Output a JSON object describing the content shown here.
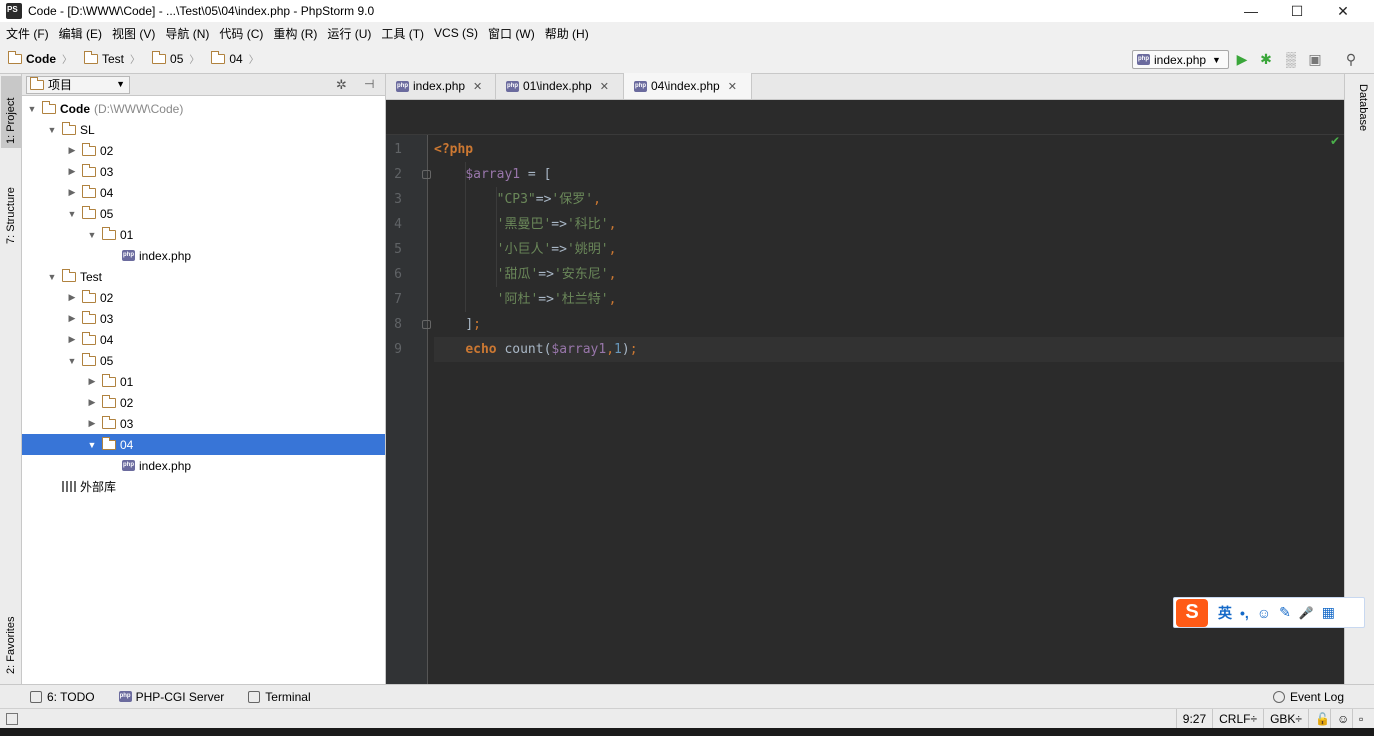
{
  "window": {
    "title": "Code - [D:\\WWW\\Code] - ...\\Test\\05\\04\\index.php - PhpStorm 9.0",
    "minimize": "—",
    "maximize": "☐",
    "close": "✕"
  },
  "menu": [
    "文件 (F)",
    "编辑 (E)",
    "视图 (V)",
    "导航 (N)",
    "代码 (C)",
    "重构 (R)",
    "运行 (U)",
    "工具 (T)",
    "VCS (S)",
    "窗口 (W)",
    "帮助 (H)"
  ],
  "breadcrumbs": [
    "Code",
    "Test",
    "05",
    "04"
  ],
  "toolbar": {
    "run_config": "index.php",
    "run_icon": "play-icon",
    "debug_icon": "bug-icon",
    "search_icon": "search-icon"
  },
  "left_stripe": {
    "project": "1: Project",
    "structure": "7: Structure",
    "favorites": "2: Favorites"
  },
  "right_stripe": {
    "database": "Database"
  },
  "project_panel": {
    "view": "项目",
    "tree": [
      {
        "label": "Code",
        "hint": "(D:\\WWW\\Code)",
        "depth": 0,
        "expanded": true,
        "type": "folder"
      },
      {
        "label": "SL",
        "depth": 1,
        "expanded": true,
        "type": "folder"
      },
      {
        "label": "02",
        "depth": 2,
        "expanded": false,
        "type": "folder"
      },
      {
        "label": "03",
        "depth": 2,
        "expanded": false,
        "type": "folder"
      },
      {
        "label": "04",
        "depth": 2,
        "expanded": false,
        "type": "folder"
      },
      {
        "label": "05",
        "depth": 2,
        "expanded": true,
        "type": "folder"
      },
      {
        "label": "01",
        "depth": 3,
        "expanded": true,
        "type": "folder"
      },
      {
        "label": "index.php",
        "depth": 4,
        "type": "php"
      },
      {
        "label": "Test",
        "depth": 1,
        "expanded": true,
        "type": "folder"
      },
      {
        "label": "02",
        "depth": 2,
        "expanded": false,
        "type": "folder"
      },
      {
        "label": "03",
        "depth": 2,
        "expanded": false,
        "type": "folder"
      },
      {
        "label": "04",
        "depth": 2,
        "expanded": false,
        "type": "folder"
      },
      {
        "label": "05",
        "depth": 2,
        "expanded": true,
        "type": "folder"
      },
      {
        "label": "01",
        "depth": 3,
        "expanded": false,
        "type": "folder"
      },
      {
        "label": "02",
        "depth": 3,
        "expanded": false,
        "type": "folder"
      },
      {
        "label": "03",
        "depth": 3,
        "expanded": false,
        "type": "folder"
      },
      {
        "label": "04",
        "depth": 3,
        "expanded": true,
        "type": "folder",
        "selected": true
      },
      {
        "label": "index.php",
        "depth": 4,
        "type": "php"
      },
      {
        "label": "外部库",
        "depth": 1,
        "type": "lib"
      }
    ]
  },
  "tabs": [
    {
      "label": "index.php",
      "active": false
    },
    {
      "label": "01\\index.php",
      "active": false
    },
    {
      "label": "04\\index.php",
      "active": true
    }
  ],
  "editor": {
    "line_numbers": [
      "1",
      "2",
      "3",
      "4",
      "5",
      "6",
      "7",
      "8",
      "9"
    ],
    "lines": [
      [
        {
          "t": "<?php",
          "c": "kw"
        }
      ],
      [
        {
          "t": "    ",
          "c": ""
        },
        {
          "t": "$array1",
          "c": "var"
        },
        {
          "t": " = [",
          "c": ""
        }
      ],
      [
        {
          "t": "        ",
          "c": ""
        },
        {
          "t": "\"CP3\"",
          "c": "str"
        },
        {
          "t": "=>",
          "c": ""
        },
        {
          "t": "'保罗'",
          "c": "str"
        },
        {
          "t": ",",
          "c": "semi"
        }
      ],
      [
        {
          "t": "        ",
          "c": ""
        },
        {
          "t": "'黑曼巴'",
          "c": "str"
        },
        {
          "t": "=>",
          "c": ""
        },
        {
          "t": "'科比'",
          "c": "str"
        },
        {
          "t": ",",
          "c": "semi"
        }
      ],
      [
        {
          "t": "        ",
          "c": ""
        },
        {
          "t": "'小巨人'",
          "c": "str"
        },
        {
          "t": "=>",
          "c": ""
        },
        {
          "t": "'姚明'",
          "c": "str"
        },
        {
          "t": ",",
          "c": "semi"
        }
      ],
      [
        {
          "t": "        ",
          "c": ""
        },
        {
          "t": "'甜瓜'",
          "c": "str"
        },
        {
          "t": "=>",
          "c": ""
        },
        {
          "t": "'安东尼'",
          "c": "str"
        },
        {
          "t": ",",
          "c": "semi"
        }
      ],
      [
        {
          "t": "        ",
          "c": ""
        },
        {
          "t": "'阿杜'",
          "c": "str"
        },
        {
          "t": "=>",
          "c": ""
        },
        {
          "t": "'杜兰特'",
          "c": "str"
        },
        {
          "t": ",",
          "c": "semi"
        }
      ],
      [
        {
          "t": "    ",
          "c": ""
        },
        {
          "t": "]",
          "c": ""
        },
        {
          "t": ";",
          "c": "semi"
        }
      ],
      [
        {
          "t": "    ",
          "c": ""
        },
        {
          "t": "echo",
          "c": "kw"
        },
        {
          "t": " count(",
          "c": "fn"
        },
        {
          "t": "$array1",
          "c": "var"
        },
        {
          "t": ",",
          "c": "semi"
        },
        {
          "t": "1",
          "c": "num"
        },
        {
          "t": ")",
          "c": "fn"
        },
        {
          "t": ";",
          "c": "semi"
        }
      ]
    ],
    "current_line": 9
  },
  "ime": {
    "logo": "S",
    "lang": "英",
    "punct": "•,",
    "emoji": "☺",
    "skin": "✎",
    "mic": "🎤",
    "grid": "▦"
  },
  "tool_tabs": {
    "todo": "6: TODO",
    "cgi": "PHP-CGI Server",
    "terminal": "Terminal",
    "event_log": "Event Log"
  },
  "status": {
    "position": "9:27",
    "line_sep": "CRLF÷",
    "encoding": "GBK÷"
  }
}
